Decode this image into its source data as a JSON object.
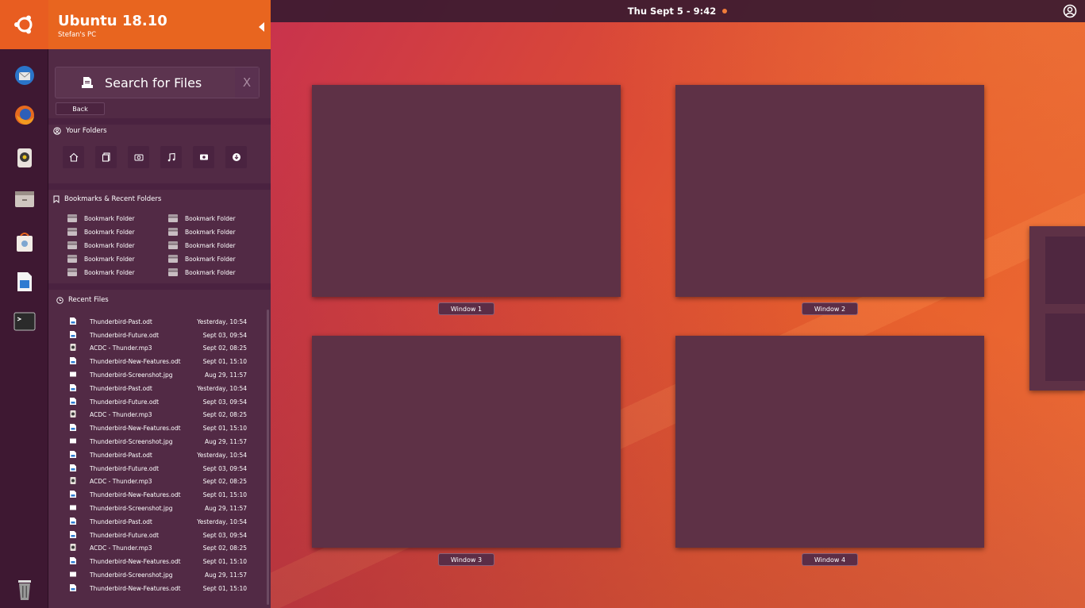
{
  "topbar": {
    "datetime": "Thu Sept 5 - 9:42"
  },
  "dash": {
    "title": "Ubuntu 18.10",
    "subtitle": "Stefan's PC",
    "search_label": "Search for Files",
    "clear_label": "X",
    "back_label": "Back",
    "folders_title": "Your Folders",
    "folder_icons": [
      "home-folder-icon",
      "documents-folder-icon",
      "pictures-folder-icon",
      "music-folder-icon",
      "videos-folder-icon",
      "downloads-folder-icon"
    ],
    "bookmarks_title": "Bookmarks & Recent Folders",
    "bookmarks": [
      "Bookmark Folder",
      "Bookmark Folder",
      "Bookmark Folder",
      "Bookmark Folder",
      "Bookmark Folder",
      "Bookmark Folder",
      "Bookmark Folder",
      "Bookmark Folder",
      "Bookmark Folder",
      "Bookmark Folder"
    ],
    "recent_title": "Recent Files",
    "recent_files": [
      {
        "name": "Thunderbird-Past.odt",
        "date": "Yesterday, 10:54",
        "type": "document"
      },
      {
        "name": "Thunderbird-Future.odt",
        "date": "Sept 03, 09:54",
        "type": "document"
      },
      {
        "name": "ACDC - Thunder.mp3",
        "date": "Sept 02, 08:25",
        "type": "audio"
      },
      {
        "name": "Thunderbird-New-Features.odt",
        "date": "Sept 01, 15:10",
        "type": "document"
      },
      {
        "name": "Thunderbird-Screenshot.jpg",
        "date": "Aug 29, 11:57",
        "type": "image"
      },
      {
        "name": "Thunderbird-Past.odt",
        "date": "Yesterday, 10:54",
        "type": "document"
      },
      {
        "name": "Thunderbird-Future.odt",
        "date": "Sept 03, 09:54",
        "type": "document"
      },
      {
        "name": "ACDC - Thunder.mp3",
        "date": "Sept 02, 08:25",
        "type": "audio"
      },
      {
        "name": "Thunderbird-New-Features.odt",
        "date": "Sept 01, 15:10",
        "type": "document"
      },
      {
        "name": "Thunderbird-Screenshot.jpg",
        "date": "Aug 29, 11:57",
        "type": "image"
      },
      {
        "name": "Thunderbird-Past.odt",
        "date": "Yesterday, 10:54",
        "type": "document"
      },
      {
        "name": "Thunderbird-Future.odt",
        "date": "Sept 03, 09:54",
        "type": "document"
      },
      {
        "name": "ACDC - Thunder.mp3",
        "date": "Sept 02, 08:25",
        "type": "audio"
      },
      {
        "name": "Thunderbird-New-Features.odt",
        "date": "Sept 01, 15:10",
        "type": "document"
      },
      {
        "name": "Thunderbird-Screenshot.jpg",
        "date": "Aug 29, 11:57",
        "type": "image"
      },
      {
        "name": "Thunderbird-Past.odt",
        "date": "Yesterday, 10:54",
        "type": "document"
      },
      {
        "name": "Thunderbird-Future.odt",
        "date": "Sept 03, 09:54",
        "type": "document"
      },
      {
        "name": "ACDC - Thunder.mp3",
        "date": "Sept 02, 08:25",
        "type": "audio"
      },
      {
        "name": "Thunderbird-New-Features.odt",
        "date": "Sept 01, 15:10",
        "type": "document"
      },
      {
        "name": "Thunderbird-Screenshot.jpg",
        "date": "Aug 29, 11:57",
        "type": "image"
      },
      {
        "name": "Thunderbird-New-Features.odt",
        "date": "Sept 01, 15:10",
        "type": "document"
      }
    ]
  },
  "launcher": {
    "apps": [
      "thunderbird-icon",
      "firefox-icon",
      "rhythmbox-icon",
      "files-icon",
      "software-center-icon",
      "libreoffice-writer-icon",
      "terminal-icon"
    ],
    "trash": "trash-icon"
  },
  "workspaces": [
    {
      "label": "Window 1"
    },
    {
      "label": "Window 2"
    },
    {
      "label": "Window 3"
    },
    {
      "label": "Window 4"
    }
  ],
  "colors": {
    "accent": "#e8651f",
    "panel": "#522a45",
    "launcher": "#3e1832"
  }
}
